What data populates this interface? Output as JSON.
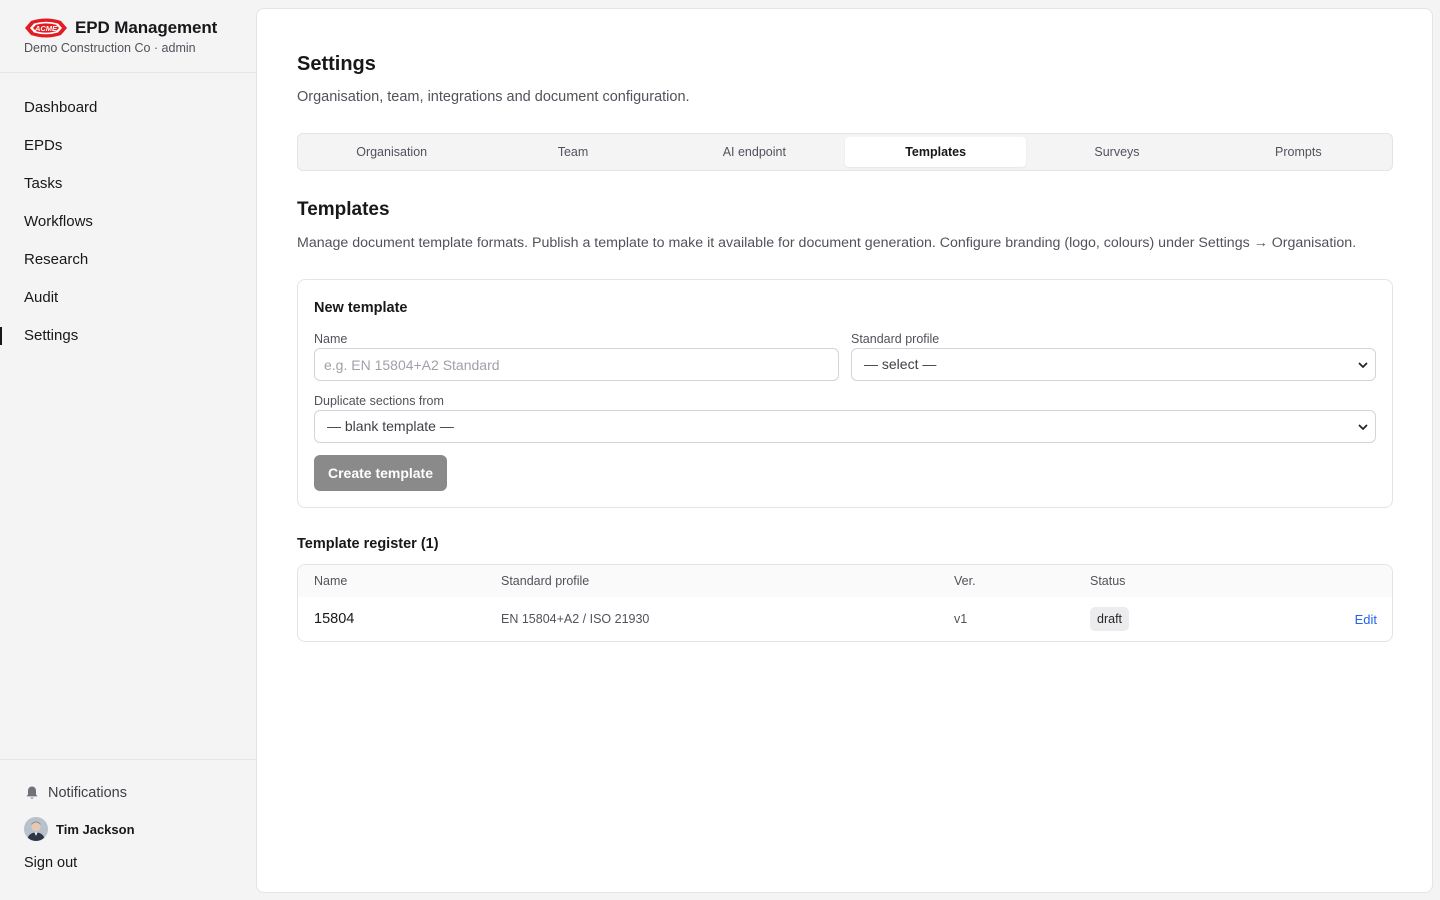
{
  "app": {
    "logo_text": "ACME",
    "title": "EPD Management",
    "subtitle": "Demo Construction Co · admin",
    "colors": {
      "logo_red": "#e11d24",
      "accent_link": "#2563eb",
      "button_disabled": "#8a8a8a"
    }
  },
  "sidebar": {
    "items": [
      {
        "label": "Dashboard"
      },
      {
        "label": "EPDs"
      },
      {
        "label": "Tasks"
      },
      {
        "label": "Workflows"
      },
      {
        "label": "Research"
      },
      {
        "label": "Audit"
      },
      {
        "label": "Settings",
        "active": true
      }
    ],
    "notifications_label": "Notifications",
    "notifications_icon": "bell-icon",
    "user_name": "Tim Jackson",
    "sign_out_label": "Sign out"
  },
  "page": {
    "title": "Settings",
    "subtitle": "Organisation, team, integrations and document configuration."
  },
  "tabs": [
    {
      "label": "Organisation"
    },
    {
      "label": "Team"
    },
    {
      "label": "AI endpoint"
    },
    {
      "label": "Templates",
      "active": true
    },
    {
      "label": "Surveys"
    },
    {
      "label": "Prompts"
    }
  ],
  "templates": {
    "title": "Templates",
    "description": "Manage document template formats. Publish a template to make it available for document generation. Configure branding (logo, colours) under Settings → Organisation.",
    "new_template": {
      "title": "New template",
      "name_label": "Name",
      "name_placeholder": "e.g. EN 15804+A2 Standard",
      "name_value": "",
      "profile_label": "Standard profile",
      "profile_selected": "— select —",
      "duplicate_label": "Duplicate sections from",
      "duplicate_selected": "— blank template —",
      "create_label": "Create template"
    },
    "register": {
      "title": "Template register (1)",
      "columns": [
        "Name",
        "Standard profile",
        "Ver.",
        "Status"
      ],
      "rows": [
        {
          "name": "15804",
          "profile": "EN 15804+A2 / ISO 21930",
          "version": "v1",
          "status": "draft",
          "action": "Edit"
        }
      ]
    }
  }
}
